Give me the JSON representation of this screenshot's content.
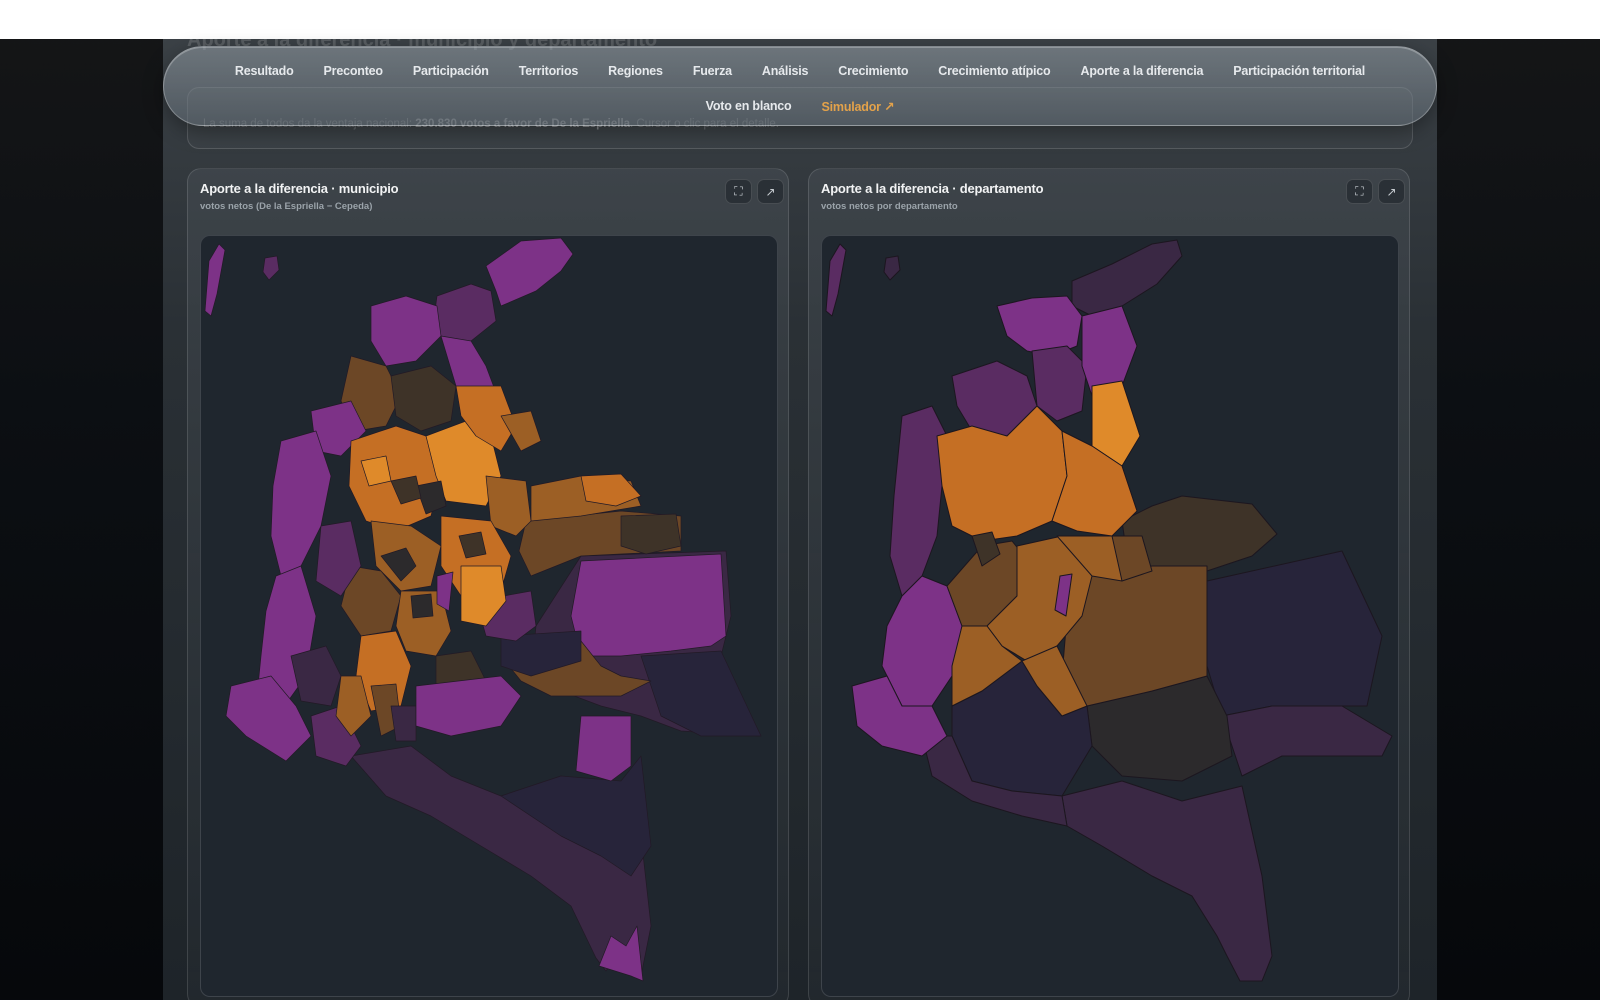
{
  "section": {
    "title": "Aporte a la diferencia · municipio y departamento",
    "info_prefix": "La suma de todos da la ventaja nacional:",
    "info_strong": "230.830 votos a favor de De la Espriella",
    "info_suffix": ". Cursor o clic para el detalle."
  },
  "nav": {
    "row1": [
      "Resultado",
      "Preconteo",
      "Participación",
      "Territorios",
      "Regiones",
      "Fuerza",
      "Análisis",
      "Crecimiento",
      "Crecimiento atípico",
      "Aporte a la diferencia",
      "Participación territorial"
    ],
    "row2": [
      "Voto en blanco",
      "Simulador ↗"
    ]
  },
  "cards": {
    "municipio": {
      "title": "Aporte a la diferencia · municipio",
      "subtitle": "votos netos (De la Espriella − Cepeda)"
    },
    "departamento": {
      "title": "Aporte a la diferencia · departamento",
      "subtitle": "votos netos por departamento"
    }
  },
  "buttons": {
    "fullscreen_icon": "⛶",
    "expand_icon": "↗"
  },
  "colors": {
    "strong_purple": "#7d3287",
    "mid_purple": "#5a2c62",
    "dark_purple": "#3a2844",
    "darkest": "#27243a",
    "neutral": "#2c2a2c",
    "dark_brown": "#3e3328",
    "brown": "#6c4726",
    "mid_orange": "#9c5f25",
    "orange": "#c56f24",
    "bright_orange": "#df8a2a",
    "map_bg": "#1f262e"
  }
}
